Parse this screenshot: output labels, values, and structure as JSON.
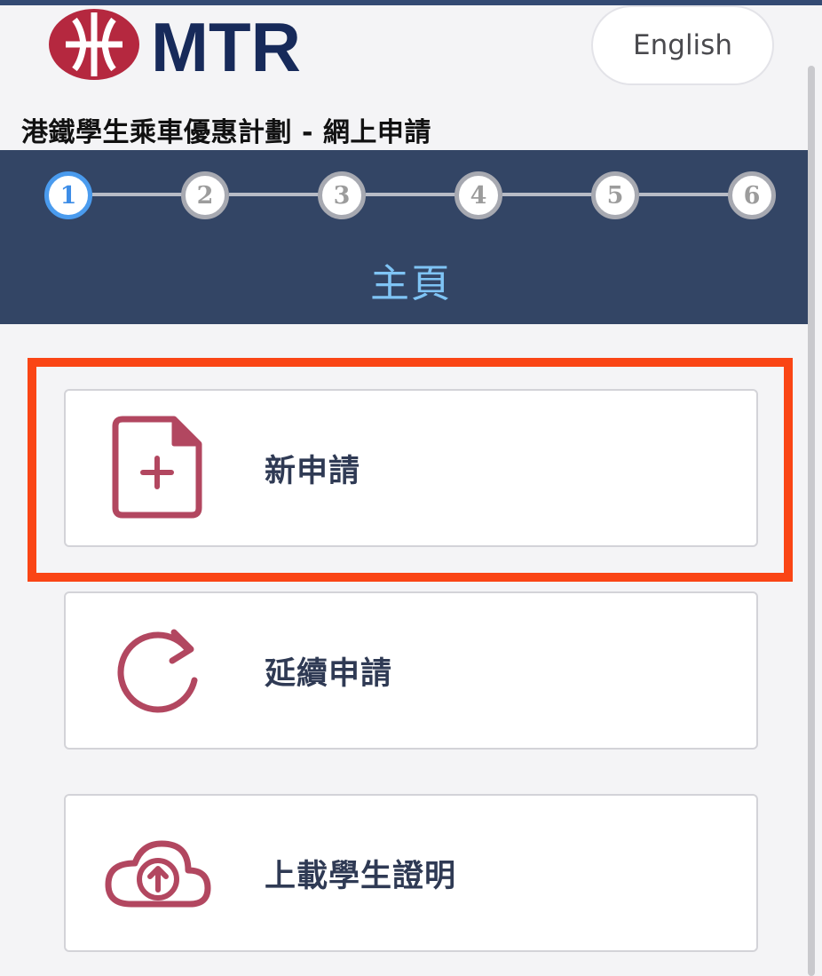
{
  "header": {
    "logo": {
      "text": "MTR",
      "icon": "mtr-logo-icon",
      "colors": {
        "emblem": "#b5283f",
        "wordmark": "#172a5a"
      }
    },
    "language_button": "English"
  },
  "page_title": "港鐵學生乘車優惠計劃 - 網上申請",
  "stepper": {
    "steps": [
      "1",
      "2",
      "3",
      "4",
      "5",
      "6"
    ],
    "active_step": "1",
    "current_step_title": "主頁",
    "colors": {
      "band": "#334565",
      "active": "#4a9bee",
      "inactive": "#a7a9b1",
      "title": "#7fc4f5"
    }
  },
  "options": [
    {
      "label": "新申請",
      "icon": "new-file-icon",
      "highlighted": true
    },
    {
      "label": "延續申請",
      "icon": "renew-icon",
      "highlighted": false
    },
    {
      "label": "上載學生證明",
      "icon": "upload-cloud-icon",
      "highlighted": false
    }
  ],
  "colors": {
    "icon": "#b24760",
    "highlight_border": "#fa4515",
    "label": "#2f3a54"
  }
}
